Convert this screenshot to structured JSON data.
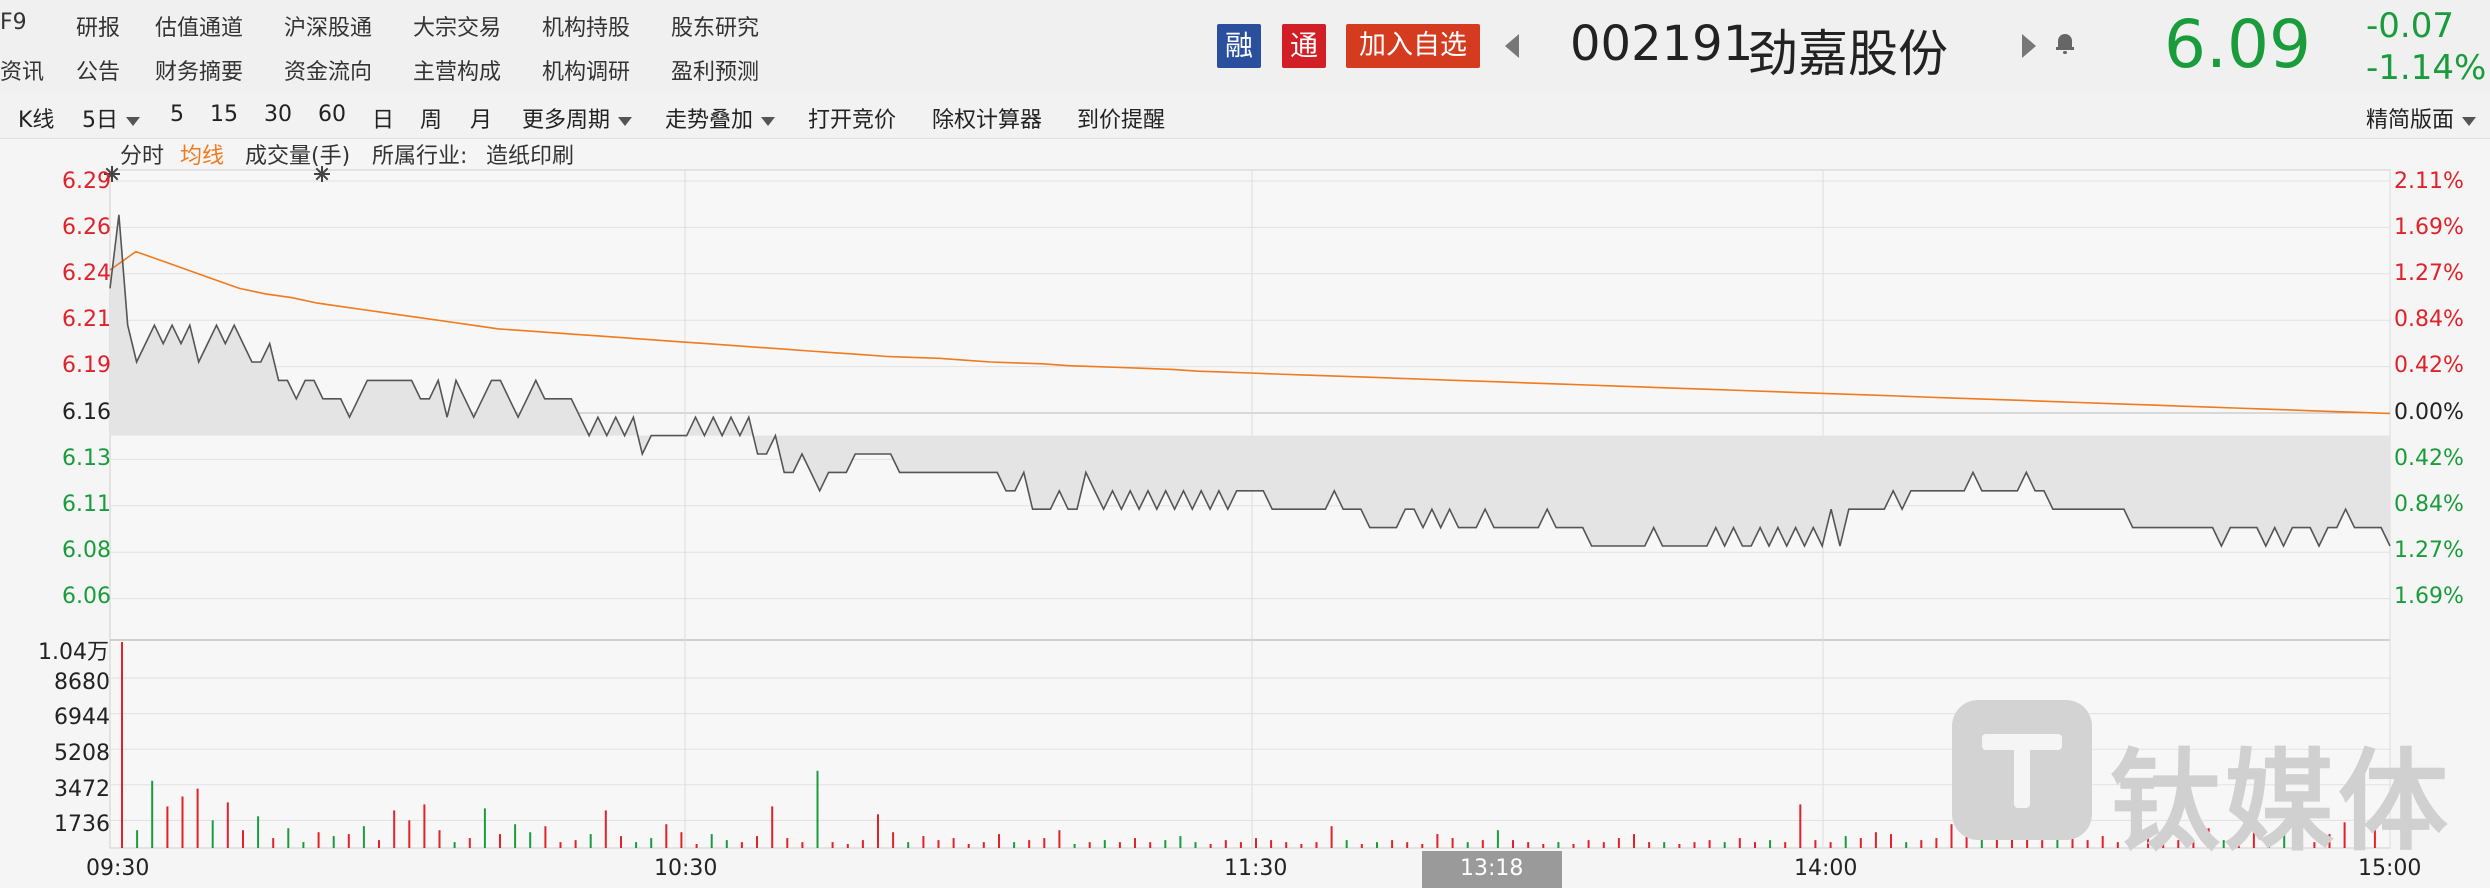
{
  "nav": {
    "row1": [
      "F9",
      "研报",
      "估值通道",
      "沪深股通",
      "大宗交易",
      "机构持股",
      "股东研究"
    ],
    "row2": [
      "资讯",
      "公告",
      "财务摘要",
      "资金流向",
      "主营构成",
      "机构调研",
      "盈利预测"
    ]
  },
  "header": {
    "badge_rong": "融",
    "badge_tong": "通",
    "add_watchlist": "加入自选",
    "code": "002191",
    "name": "劲嘉股份",
    "price": "6.09",
    "change": "-0.07",
    "change_pct": "-1.14%",
    "colors": {
      "down": "#1a9c3c",
      "up": "#e0222a",
      "rong_bg": "#2a4f9c",
      "tong_bg": "#d21e25",
      "add_bg": "#d43b1f"
    }
  },
  "toolbar": {
    "items": [
      "K线",
      "5日",
      "5",
      "15",
      "30",
      "60",
      "日",
      "周",
      "月",
      "更多周期",
      "走势叠加",
      "打开竞价",
      "除权计算器",
      "到价提醒"
    ],
    "right": "精简版面"
  },
  "legend": {
    "fenshi": "分时",
    "junxian": "均线",
    "volume": "成交量(手)",
    "industry_label": "所属行业:",
    "industry": "造纸印刷"
  },
  "chart_data": {
    "type": "line",
    "price_axis_left": [
      "6.29",
      "6.26",
      "6.24",
      "6.21",
      "6.19",
      "6.16",
      "6.13",
      "6.11",
      "6.08",
      "6.06"
    ],
    "pct_axis_right": [
      "2.11%",
      "1.69%",
      "1.27%",
      "0.84%",
      "0.42%",
      "0.00%",
      "0.42%",
      "0.84%",
      "1.27%",
      "1.69%"
    ],
    "volume_axis": [
      "1.04万",
      "8680",
      "6944",
      "5208",
      "3472",
      "1736"
    ],
    "time_axis": [
      "09:30",
      "10:30",
      "11:30",
      "13:18",
      "14:00",
      "15:00"
    ],
    "prev_close": 6.16,
    "ylim": [
      6.05,
      6.3
    ],
    "volume_max": 10400,
    "series": [
      {
        "values": [
          6.24,
          6.28,
          6.22,
          6.2,
          6.21,
          6.22,
          6.21,
          6.22,
          6.21,
          6.22,
          6.2,
          6.21,
          6.22,
          6.21,
          6.22,
          6.21,
          6.2,
          6.2,
          6.21,
          6.19,
          6.19,
          6.18,
          6.19,
          6.19,
          6.18,
          6.18,
          6.18,
          6.17,
          6.18,
          6.19,
          6.19,
          6.19,
          6.19,
          6.19,
          6.19,
          6.18,
          6.18,
          6.19,
          6.17,
          6.19,
          6.18,
          6.17,
          6.18,
          6.19,
          6.19,
          6.18,
          6.17,
          6.18,
          6.19,
          6.18,
          6.18,
          6.18,
          6.18,
          6.17,
          6.16,
          6.17,
          6.16,
          6.17,
          6.16,
          6.17,
          6.15,
          6.16,
          6.16,
          6.16,
          6.16,
          6.16,
          6.17,
          6.16,
          6.17,
          6.16,
          6.17,
          6.16,
          6.17,
          6.15,
          6.15,
          6.16,
          6.14,
          6.14,
          6.15,
          6.14,
          6.13,
          6.14,
          6.14,
          6.14,
          6.15,
          6.15,
          6.15,
          6.15,
          6.15,
          6.14,
          6.14,
          6.14,
          6.14,
          6.14,
          6.14,
          6.14,
          6.14,
          6.14,
          6.14,
          6.14,
          6.14,
          6.13,
          6.13,
          6.14,
          6.12,
          6.12,
          6.12,
          6.13,
          6.12,
          6.12,
          6.14,
          6.13,
          6.12,
          6.13,
          6.12,
          6.13,
          6.12,
          6.13,
          6.12,
          6.13,
          6.12,
          6.13,
          6.12,
          6.13,
          6.12,
          6.13,
          6.12,
          6.13,
          6.13,
          6.13,
          6.13,
          6.12,
          6.12,
          6.12,
          6.12,
          6.12,
          6.12,
          6.12,
          6.13,
          6.12,
          6.12,
          6.12,
          6.11,
          6.11,
          6.11,
          6.11,
          6.12,
          6.12,
          6.11,
          6.12,
          6.11,
          6.12,
          6.11,
          6.11,
          6.11,
          6.12,
          6.11,
          6.11,
          6.11,
          6.11,
          6.11,
          6.11,
          6.12,
          6.11,
          6.11,
          6.11,
          6.11,
          6.1,
          6.1,
          6.1,
          6.1,
          6.1,
          6.1,
          6.1,
          6.11,
          6.1,
          6.1,
          6.1,
          6.1,
          6.1,
          6.1,
          6.11,
          6.1,
          6.11,
          6.1,
          6.1,
          6.11,
          6.1,
          6.11,
          6.1,
          6.11,
          6.1,
          6.11,
          6.1,
          6.12,
          6.1,
          6.12,
          6.12,
          6.12,
          6.12,
          6.12,
          6.13,
          6.12,
          6.13,
          6.13,
          6.13,
          6.13,
          6.13,
          6.13,
          6.13,
          6.14,
          6.13,
          6.13,
          6.13,
          6.13,
          6.13,
          6.14,
          6.13,
          6.13,
          6.12,
          6.12,
          6.12,
          6.12,
          6.12,
          6.12,
          6.12,
          6.12,
          6.12,
          6.11,
          6.11,
          6.11,
          6.11,
          6.11,
          6.11,
          6.11,
          6.11,
          6.11,
          6.11,
          6.1,
          6.11,
          6.11,
          6.11,
          6.11,
          6.1,
          6.11,
          6.1,
          6.11,
          6.11,
          6.11,
          6.1,
          6.11,
          6.11,
          6.12,
          6.11,
          6.11,
          6.11,
          6.11,
          6.1
        ]
      },
      {
        "values": [
          6.25,
          6.26,
          6.255,
          6.25,
          6.245,
          6.24,
          6.237,
          6.235,
          6.232,
          6.23,
          6.228,
          6.226,
          6.224,
          6.222,
          6.22,
          6.218,
          6.217,
          6.216,
          6.215,
          6.214,
          6.213,
          6.212,
          6.211,
          6.21,
          6.209,
          6.208,
          6.207,
          6.206,
          6.205,
          6.204,
          6.203,
          6.2025,
          6.202,
          6.201,
          6.2,
          6.1995,
          6.199,
          6.198,
          6.1975,
          6.197,
          6.1965,
          6.196,
          6.195,
          6.1945,
          6.194,
          6.1935,
          6.193,
          6.1925,
          6.192,
          6.1915,
          6.191,
          6.1905,
          6.19,
          6.1895,
          6.189,
          6.1885,
          6.188,
          6.1875,
          6.187,
          6.1865,
          6.186,
          6.1855,
          6.185,
          6.1845,
          6.184,
          6.1835,
          6.183,
          6.1825,
          6.182,
          6.1815,
          6.181,
          6.1805,
          6.18,
          6.1795,
          6.179,
          6.1785,
          6.178,
          6.1775,
          6.177,
          6.1765,
          6.176,
          6.1755,
          6.175,
          6.1745,
          6.174,
          6.1735,
          6.173,
          6.1725,
          6.172
        ]
      }
    ],
    "volume": [
      10400,
      900,
      3400,
      2100,
      2600,
      3000,
      1400,
      2300,
      900,
      1600,
      500,
      1000,
      300,
      800,
      600,
      700,
      1100,
      400,
      1900,
      1400,
      2200,
      900,
      300,
      500,
      2000,
      700,
      1200,
      800,
      1100,
      300,
      400,
      700,
      1900,
      600,
      300,
      500,
      1200,
      800,
      200,
      700,
      400,
      300,
      600,
      2100,
      500,
      300,
      3900,
      300,
      200,
      400,
      1700,
      800,
      300,
      600,
      400,
      500,
      200,
      300,
      700,
      300,
      400,
      500,
      900,
      200,
      300,
      400,
      300,
      500,
      300,
      400,
      600,
      300,
      200,
      400,
      300,
      500,
      400,
      300,
      200,
      300,
      1100,
      400,
      200,
      300,
      400,
      300,
      200,
      700,
      500,
      300,
      400,
      900,
      400,
      300,
      200,
      300,
      200,
      400,
      300,
      500,
      700,
      300,
      300,
      200,
      300,
      400,
      300,
      500,
      300,
      400,
      300,
      2200,
      400,
      300,
      600,
      500,
      800,
      700,
      300,
      400,
      500,
      1200,
      600,
      800,
      1100,
      1300,
      500,
      400,
      900,
      700,
      400,
      600,
      300,
      800,
      500,
      700,
      400,
      300,
      1000,
      400,
      600,
      800,
      500,
      1100,
      400,
      300,
      700,
      1300,
      500,
      1600
    ]
  }
}
